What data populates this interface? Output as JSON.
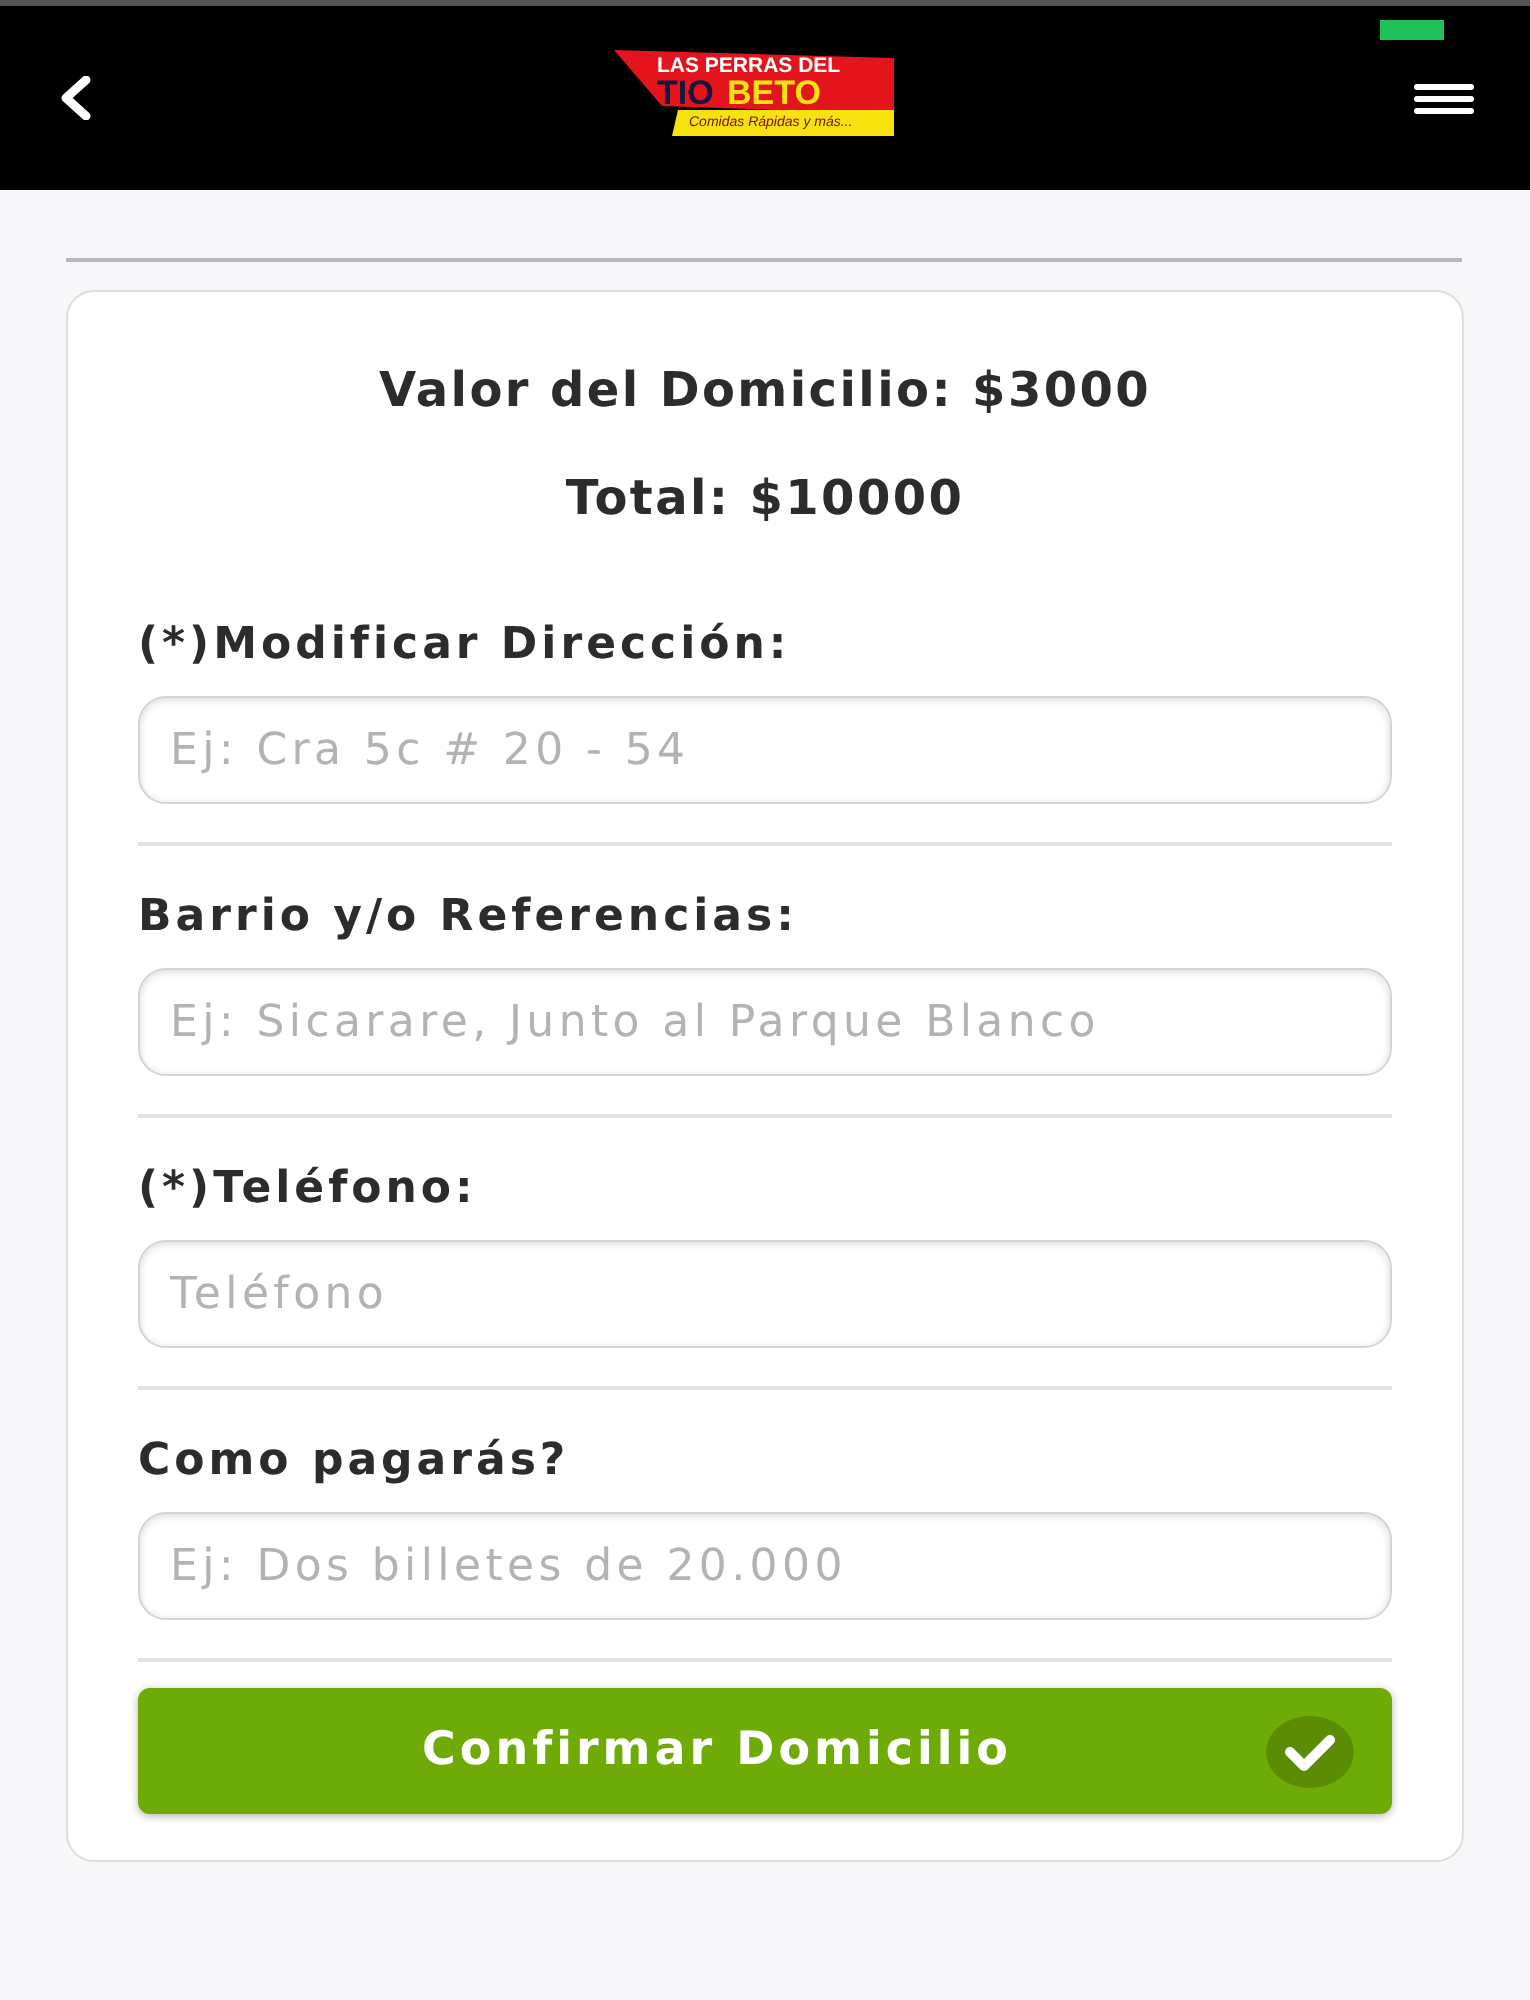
{
  "header": {
    "logo": {
      "line_1": "LAS PERRAS DEL",
      "line_2_dark": "TIO",
      "line_2_bright": "BETO",
      "tagline": "Comidas Rápidas y más..."
    }
  },
  "summary": {
    "delivery_fee": "Valor del Domicilio: $3000",
    "total": "Total: $10000"
  },
  "fields": [
    {
      "label": "(*)Modificar Dirección:",
      "placeholder": "Ej: Cra 5c # 20 - 54"
    },
    {
      "label": "Barrio y/o Referencias:",
      "placeholder": "Ej: Sicarare, Junto al Parque Blanco"
    },
    {
      "label": "(*)Teléfono:",
      "placeholder": "Teléfono"
    },
    {
      "label": "Como pagarás?",
      "placeholder": "Ej: Dos billetes de 20.000"
    }
  ],
  "submit_button": {
    "label": "Confirmar Domicilio"
  }
}
